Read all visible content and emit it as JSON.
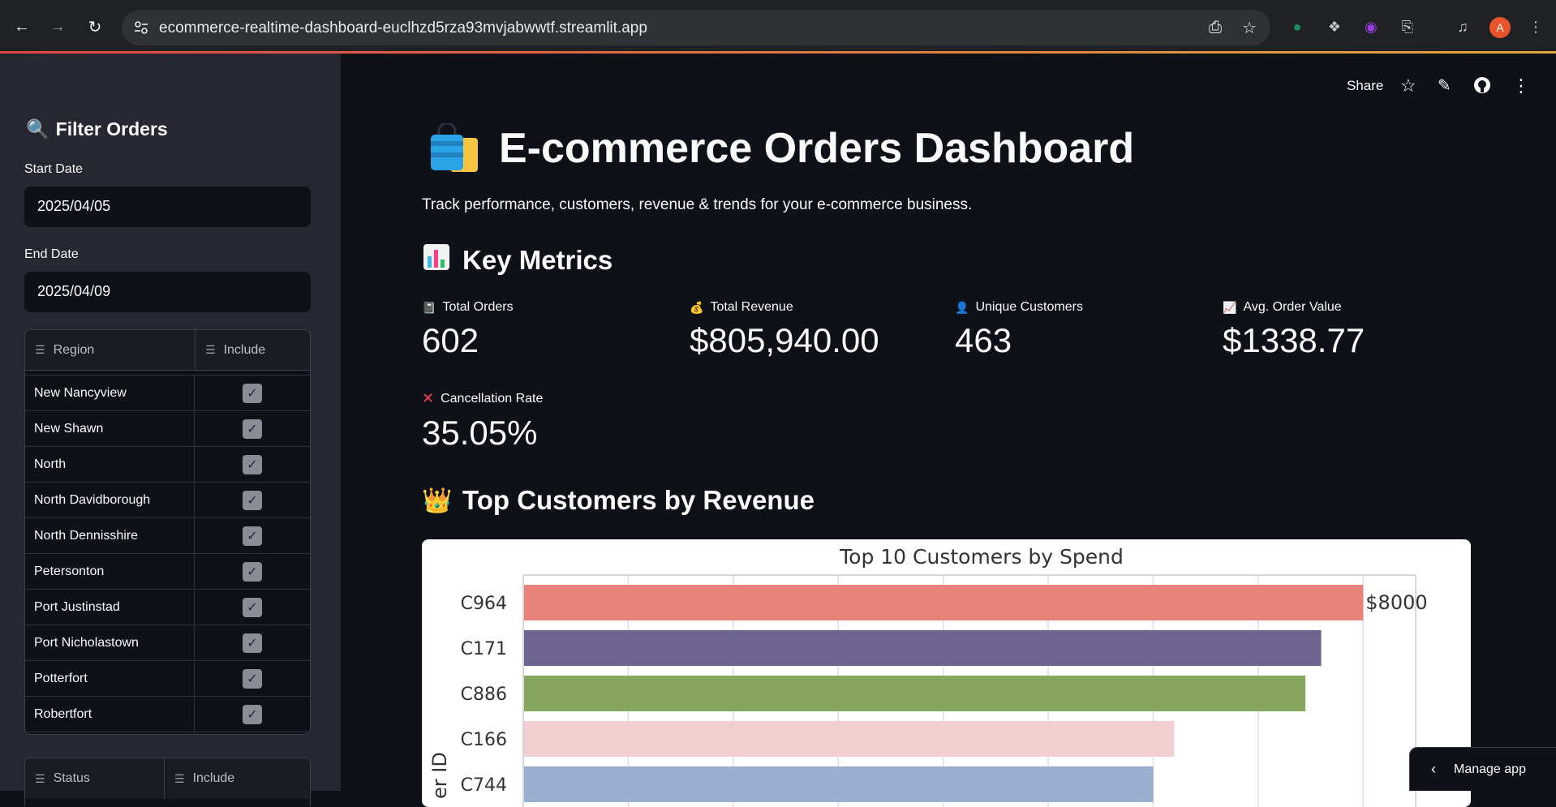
{
  "browser": {
    "url": "ecommerce-realtime-dashboard-euclhzd5rza93mvjabwwtf.streamlit.app",
    "avatar_letter": "A"
  },
  "sidebar": {
    "title": "Filter Orders",
    "start_date_label": "Start Date",
    "start_date_value": "2025/04/05",
    "end_date_label": "End Date",
    "end_date_value": "2025/04/09",
    "region_table": {
      "col_region": "Region",
      "col_include": "Include",
      "rows": [
        "New Nancyview",
        "New Shawn",
        "North",
        "North Davidborough",
        "North Dennisshire",
        "Petersonton",
        "Port Justinstad",
        "Port Nicholastown",
        "Potterfort",
        "Robertfort"
      ]
    },
    "status_table": {
      "col_status": "Status",
      "col_include": "Include"
    }
  },
  "toolbar": {
    "share_label": "Share"
  },
  "main": {
    "title": "E-commerce Orders Dashboard",
    "subtitle": "Track performance, customers, revenue & trends for your e-commerce business.",
    "key_metrics_heading": "Key Metrics",
    "metrics": [
      {
        "label": "Total Orders",
        "value": "602",
        "icon": "receipt-icon"
      },
      {
        "label": "Total Revenue",
        "value": "$805,940.00",
        "icon": "money-bag-icon"
      },
      {
        "label": "Unique Customers",
        "value": "463",
        "icon": "user-icon"
      },
      {
        "label": "Avg. Order Value",
        "value": "$1338.77",
        "icon": "chart-increasing-icon"
      },
      {
        "label": "Cancellation Rate",
        "value": "35.05%",
        "icon": "cross-mark-icon"
      }
    ],
    "top_customers_heading": "Top Customers by Revenue"
  },
  "chart_data": {
    "type": "bar",
    "orientation": "horizontal",
    "title": "Top 10 Customers by Spend",
    "ylabel": "er ID",
    "categories": [
      "C964",
      "C171",
      "C886",
      "C166",
      "C744"
    ],
    "values": [
      8000,
      7600,
      7450,
      6200,
      6000
    ],
    "colors": [
      "#e8837a",
      "#6e6490",
      "#86a55e",
      "#f1cfd0",
      "#9aaed0"
    ],
    "data_labels": [
      "$8000"
    ],
    "xlim": [
      0,
      8500
    ],
    "grid": true
  },
  "manage_app_label": "Manage app"
}
